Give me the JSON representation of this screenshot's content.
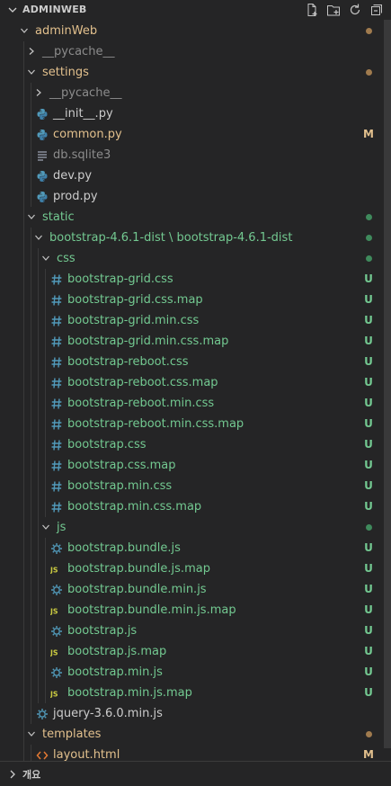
{
  "explorer": {
    "section_title": "ADMINWEB",
    "outline_title": "개요"
  },
  "colors": {
    "modified": "#e2c08d",
    "untracked": "#73c991",
    "ignored": "#8c8c8c",
    "dot_modified": "#a07b4e",
    "dot_untracked": "#3f8a5c"
  },
  "tree": [
    {
      "label": "adminWeb",
      "depth": 0,
      "type": "folder",
      "open": true,
      "color": "mod",
      "deco": "dot-mod"
    },
    {
      "label": "__pycache__",
      "depth": 1,
      "type": "folder",
      "open": false,
      "color": "ign",
      "deco": ""
    },
    {
      "label": "settings",
      "depth": 1,
      "type": "folder",
      "open": true,
      "color": "mod",
      "deco": "dot-mod"
    },
    {
      "label": "__pycache__",
      "depth": 2,
      "type": "folder",
      "open": false,
      "color": "ign",
      "deco": ""
    },
    {
      "label": "__init__.py",
      "depth": 2,
      "type": "file",
      "icon": "python-icon",
      "color": "plain",
      "deco": ""
    },
    {
      "label": "common.py",
      "depth": 2,
      "type": "file",
      "icon": "python-icon",
      "color": "mod",
      "deco": "M"
    },
    {
      "label": "db.sqlite3",
      "depth": 2,
      "type": "file",
      "icon": "lines-icon",
      "color": "ign",
      "deco": ""
    },
    {
      "label": "dev.py",
      "depth": 2,
      "type": "file",
      "icon": "python-icon",
      "color": "plain",
      "deco": ""
    },
    {
      "label": "prod.py",
      "depth": 2,
      "type": "file",
      "icon": "python-icon",
      "color": "plain",
      "deco": ""
    },
    {
      "label": "static",
      "depth": 1,
      "type": "folder",
      "open": true,
      "color": "untr",
      "deco": "dot-untr"
    },
    {
      "label": "bootstrap-4.6.1-dist \\ bootstrap-4.6.1-dist",
      "depth": 2,
      "type": "folder",
      "open": true,
      "color": "untr",
      "deco": "dot-untr"
    },
    {
      "label": "css",
      "depth": 3,
      "type": "folder",
      "open": true,
      "color": "untr",
      "deco": "dot-untr"
    },
    {
      "label": "bootstrap-grid.css",
      "depth": 4,
      "type": "file",
      "icon": "hash-icon",
      "color": "untr",
      "deco": "U"
    },
    {
      "label": "bootstrap-grid.css.map",
      "depth": 4,
      "type": "file",
      "icon": "hash-icon",
      "color": "untr",
      "deco": "U"
    },
    {
      "label": "bootstrap-grid.min.css",
      "depth": 4,
      "type": "file",
      "icon": "hash-icon",
      "color": "untr",
      "deco": "U"
    },
    {
      "label": "bootstrap-grid.min.css.map",
      "depth": 4,
      "type": "file",
      "icon": "hash-icon",
      "color": "untr",
      "deco": "U"
    },
    {
      "label": "bootstrap-reboot.css",
      "depth": 4,
      "type": "file",
      "icon": "hash-icon",
      "color": "untr",
      "deco": "U"
    },
    {
      "label": "bootstrap-reboot.css.map",
      "depth": 4,
      "type": "file",
      "icon": "hash-icon",
      "color": "untr",
      "deco": "U"
    },
    {
      "label": "bootstrap-reboot.min.css",
      "depth": 4,
      "type": "file",
      "icon": "hash-icon",
      "color": "untr",
      "deco": "U"
    },
    {
      "label": "bootstrap-reboot.min.css.map",
      "depth": 4,
      "type": "file",
      "icon": "hash-icon",
      "color": "untr",
      "deco": "U"
    },
    {
      "label": "bootstrap.css",
      "depth": 4,
      "type": "file",
      "icon": "hash-icon",
      "color": "untr",
      "deco": "U"
    },
    {
      "label": "bootstrap.css.map",
      "depth": 4,
      "type": "file",
      "icon": "hash-icon",
      "color": "untr",
      "deco": "U"
    },
    {
      "label": "bootstrap.min.css",
      "depth": 4,
      "type": "file",
      "icon": "hash-icon",
      "color": "untr",
      "deco": "U"
    },
    {
      "label": "bootstrap.min.css.map",
      "depth": 4,
      "type": "file",
      "icon": "hash-icon",
      "color": "untr",
      "deco": "U"
    },
    {
      "label": "js",
      "depth": 3,
      "type": "folder",
      "open": true,
      "color": "untr",
      "deco": "dot-untr"
    },
    {
      "label": "bootstrap.bundle.js",
      "depth": 4,
      "type": "file",
      "icon": "gear-icon",
      "color": "untr",
      "deco": "U"
    },
    {
      "label": "bootstrap.bundle.js.map",
      "depth": 4,
      "type": "file",
      "icon": "js-icon",
      "color": "untr",
      "deco": "U"
    },
    {
      "label": "bootstrap.bundle.min.js",
      "depth": 4,
      "type": "file",
      "icon": "gear-icon",
      "color": "untr",
      "deco": "U"
    },
    {
      "label": "bootstrap.bundle.min.js.map",
      "depth": 4,
      "type": "file",
      "icon": "js-icon",
      "color": "untr",
      "deco": "U"
    },
    {
      "label": "bootstrap.js",
      "depth": 4,
      "type": "file",
      "icon": "gear-icon",
      "color": "untr",
      "deco": "U"
    },
    {
      "label": "bootstrap.js.map",
      "depth": 4,
      "type": "file",
      "icon": "js-icon",
      "color": "untr",
      "deco": "U"
    },
    {
      "label": "bootstrap.min.js",
      "depth": 4,
      "type": "file",
      "icon": "gear-icon",
      "color": "untr",
      "deco": "U"
    },
    {
      "label": "bootstrap.min.js.map",
      "depth": 4,
      "type": "file",
      "icon": "js-icon",
      "color": "untr",
      "deco": "U"
    },
    {
      "label": "jquery-3.6.0.min.js",
      "depth": 2,
      "type": "file",
      "icon": "gear-icon",
      "color": "plain",
      "deco": ""
    },
    {
      "label": "templates",
      "depth": 1,
      "type": "folder",
      "open": true,
      "color": "mod",
      "deco": "dot-mod"
    },
    {
      "label": "layout.html",
      "depth": 2,
      "type": "file",
      "icon": "html-icon",
      "color": "mod",
      "deco": "M"
    }
  ]
}
